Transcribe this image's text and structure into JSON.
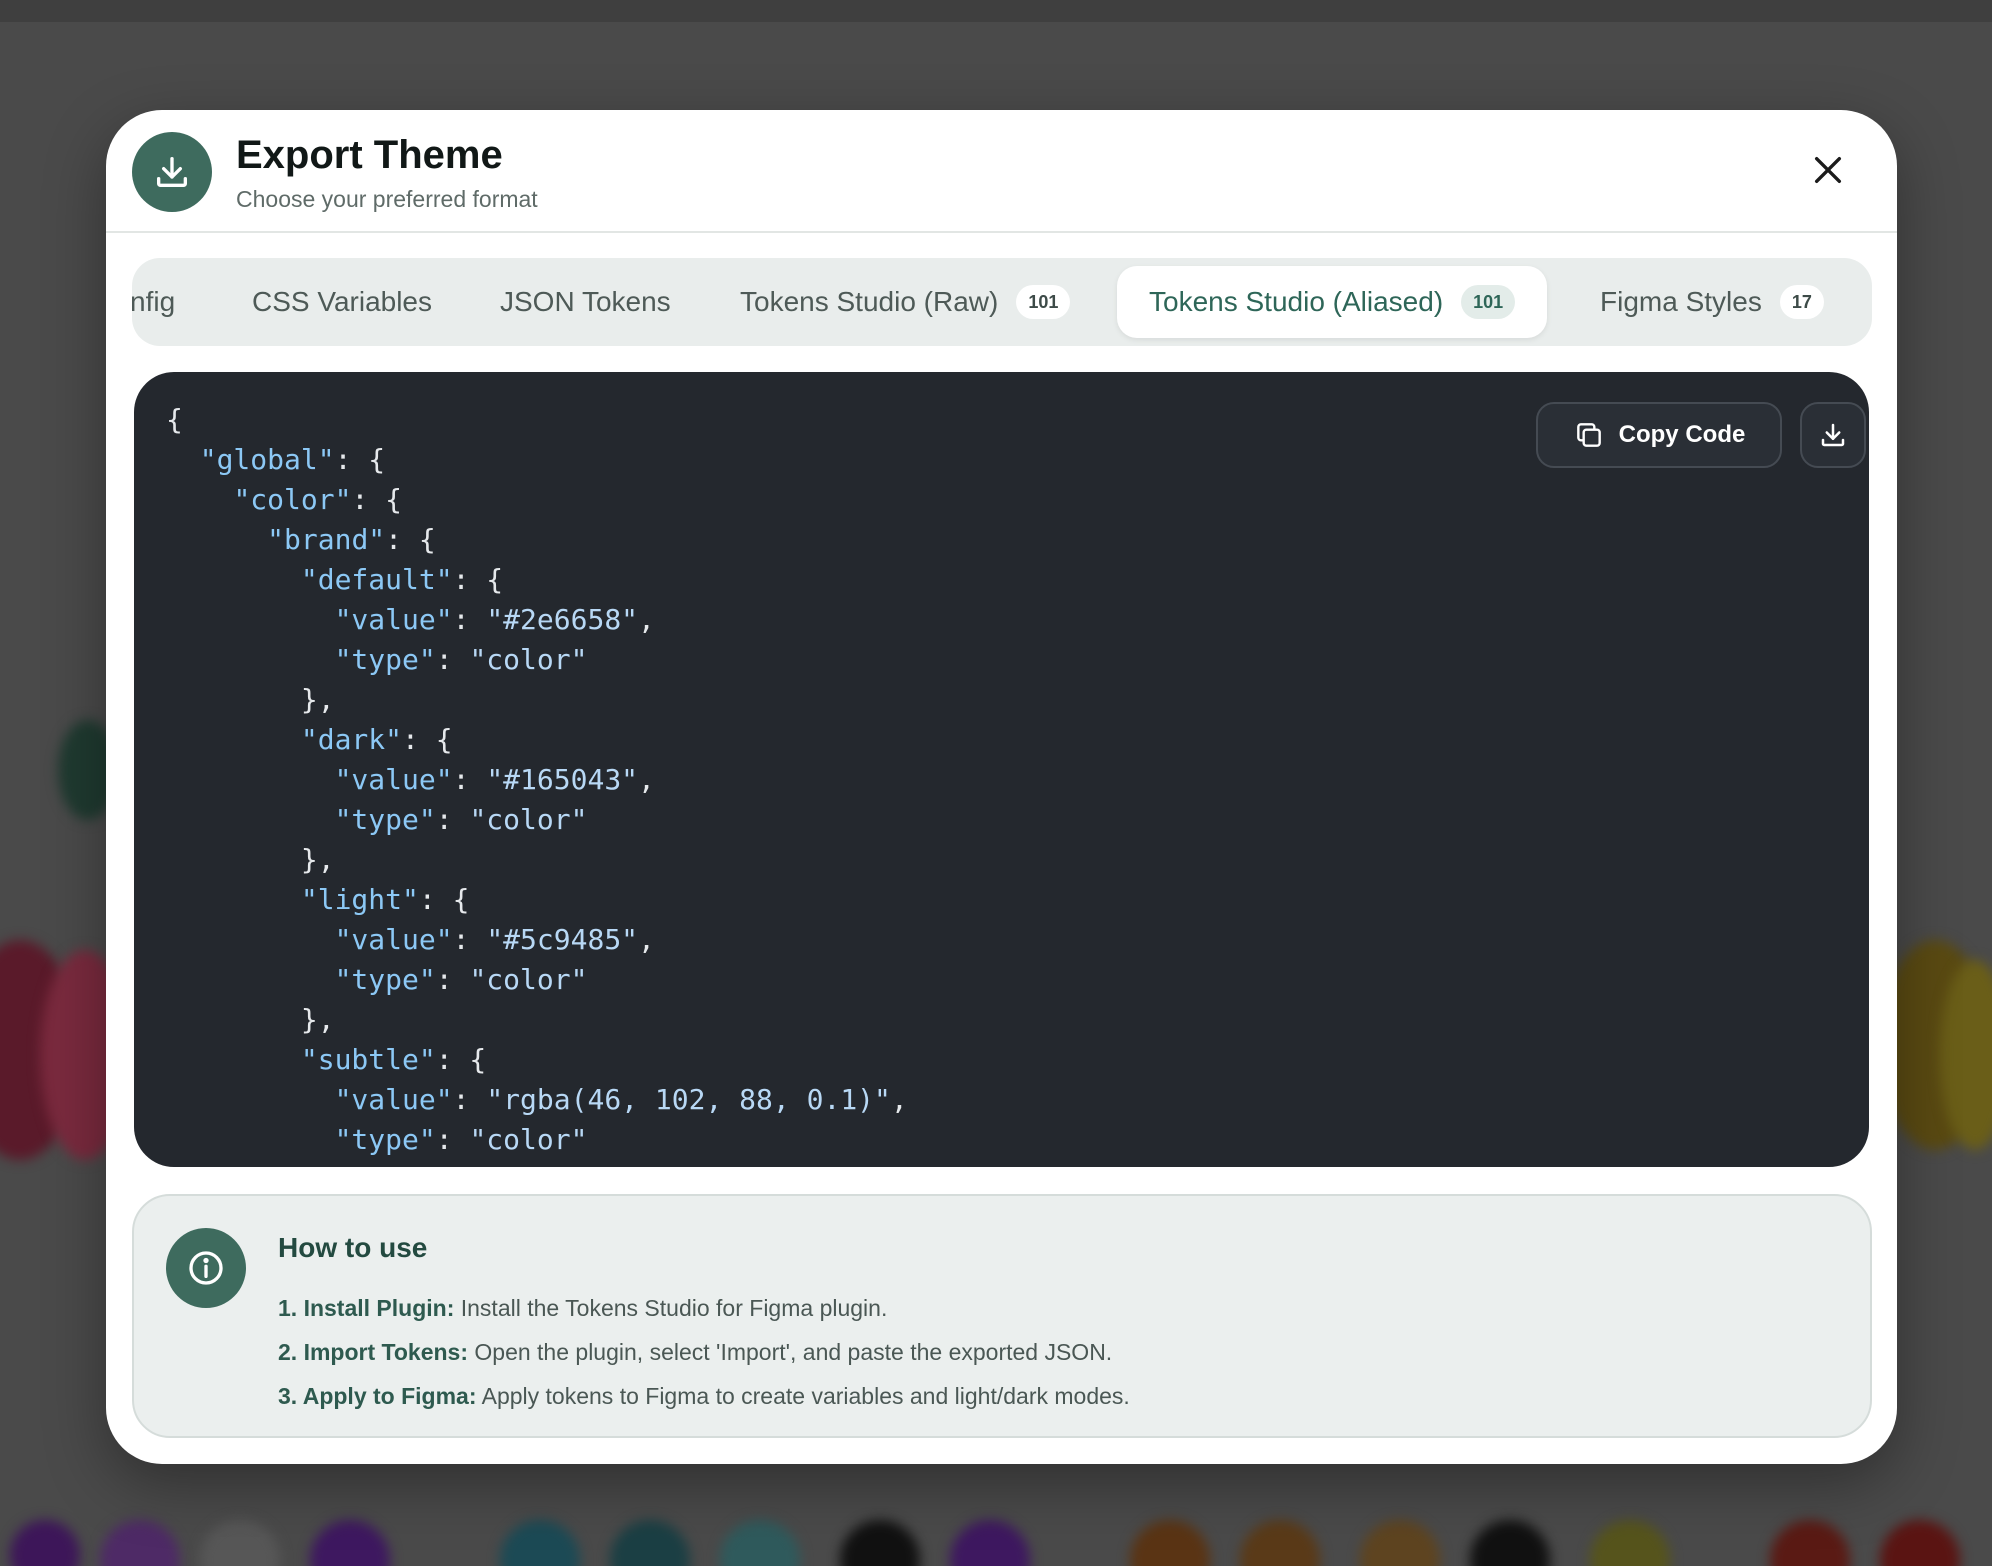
{
  "modal": {
    "title": "Export Theme",
    "subtitle": "Choose your preferred format",
    "header_icon": "download-icon",
    "close_icon": "close-icon"
  },
  "tabs": [
    {
      "label": "Config",
      "visible_label": "nfig",
      "badge": null,
      "active": false
    },
    {
      "label": "CSS Variables",
      "badge": null,
      "active": false
    },
    {
      "label": "JSON Tokens",
      "badge": null,
      "active": false
    },
    {
      "label": "Tokens Studio (Raw)",
      "badge": "101",
      "active": false
    },
    {
      "label": "Tokens Studio (Aliased)",
      "badge": "101",
      "active": true
    },
    {
      "label": "Figma Styles",
      "badge": "17",
      "active": false
    }
  ],
  "code": {
    "copy_label": "Copy Code",
    "copy_icon": "copy-icon",
    "download_icon": "download-icon",
    "lines": [
      "{",
      "  \"global\": {",
      "    \"color\": {",
      "      \"brand\": {",
      "        \"default\": {",
      "          \"value\": \"#2e6658\",",
      "          \"type\": \"color\"",
      "        },",
      "        \"dark\": {",
      "          \"value\": \"#165043\",",
      "          \"type\": \"color\"",
      "        },",
      "        \"light\": {",
      "          \"value\": \"#5c9485\",",
      "          \"type\": \"color\"",
      "        },",
      "        \"subtle\": {",
      "          \"value\": \"rgba(46, 102, 88, 0.1)\",",
      "          \"type\": \"color\""
    ]
  },
  "howto": {
    "icon": "info-icon",
    "title": "How to use",
    "steps": [
      {
        "label": "1. Install Plugin:",
        "text": " Install the Tokens Studio for Figma plugin."
      },
      {
        "label": "2. Import Tokens:",
        "text": " Open the plugin, select 'Import', and paste the exported JSON."
      },
      {
        "label": "3. Apply to Figma:",
        "text": " Apply tokens to Figma to create variables and light/dark modes."
      }
    ]
  },
  "colors": {
    "accent": "#2e6658",
    "accent_dark": "#3e6b5e",
    "code_bg": "#24282e",
    "overlay": "#4a4a4a"
  }
}
